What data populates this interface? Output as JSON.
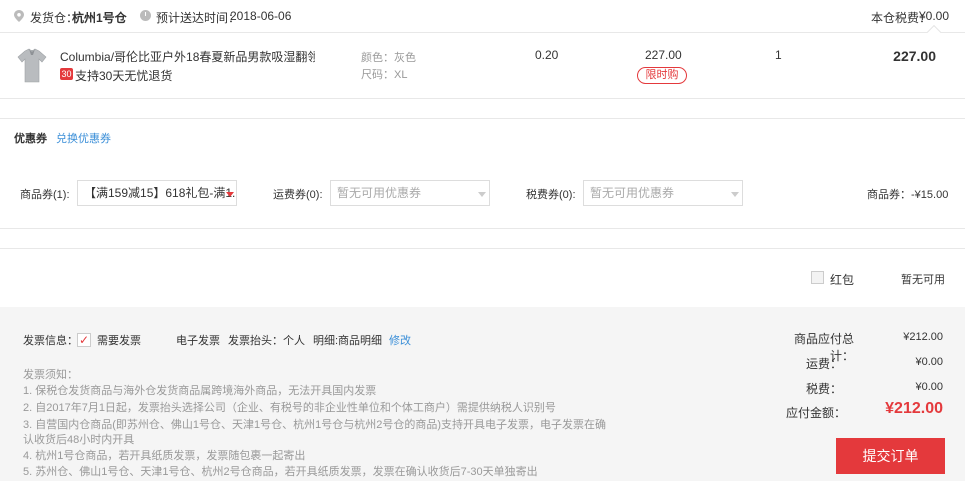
{
  "header": {
    "ship_label": "发货仓：",
    "warehouse": "杭州1号仓",
    "delivery_label": "预计送达时间：",
    "delivery_date": "2018-06-06",
    "tax_label": "本仓税费：",
    "tax_value": "¥0.00"
  },
  "product": {
    "name": "Columbia/哥伦比亚户外18春夏新品男款吸湿翻领P...",
    "badge": "30",
    "return_text": "支持30天无忧退货",
    "color_label": "颜色：灰色",
    "size_label": "尺码：XL",
    "tax_rate": "0.20",
    "price": "227.00",
    "promo_tag": "限时购",
    "quantity": "1",
    "subtotal": "227.00"
  },
  "coupons": {
    "title": "优惠券",
    "exchange_link": "兑换优惠券",
    "product_coupon_label": "商品券(1):",
    "product_coupon_value": "【满159减15】618礼包-满1...",
    "shipping_coupon_label": "运费券(0):",
    "shipping_coupon_value": "暂无可用优惠券",
    "tax_coupon_label": "税费券(0):",
    "tax_coupon_value": "暂无可用优惠券",
    "discount_text": "商品券：-¥15.00"
  },
  "red_packet": {
    "label": "红包",
    "status": "暂无可用"
  },
  "invoice": {
    "info_label": "发票信息：",
    "need_label": "需要发票",
    "type": "电子发票",
    "header_text": "发票抬头：个人",
    "detail_text": "明细:商品明细",
    "edit_link": "修改",
    "notice_title": "发票须知：",
    "notices": [
      "1. 保税仓发货商品与海外仓发货商品属跨境海外商品，无法开具国内发票",
      "2. 自2017年7月1日起，发票抬头选择公司（企业、有税号的非企业性单位和个体工商户）需提供纳税人识别号",
      "3. 自营国内仓商品(即苏州仓、佛山1号仓、天津1号仓、杭州1号仓与杭州2号仓的商品)支持开具电子发票，电子发票在确",
      "认收货后48小时内开具",
      "4. 杭州1号仓商品，若开具纸质发票，发票随包裹一起寄出",
      "5. 苏州仓、佛山1号仓、天津1号仓、杭州2号仓商品，若开具纸质发票，发票在确认收货后7-30天单独寄出"
    ]
  },
  "summary": {
    "goods_total_label": "商品应付总计：",
    "goods_total_value": "¥212.00",
    "freight_label": "运费：",
    "freight_value": "¥0.00",
    "tax_label": "税费：",
    "tax_value": "¥0.00",
    "pay_label": "应付金额：",
    "pay_value": "¥212.00",
    "submit_label": "提交订单"
  },
  "colors": {
    "accent": "#e4393c",
    "link": "#3b8fd8",
    "summary_bg": "#f5f5f5"
  },
  "icons": [
    "location-pin-icon",
    "clock-icon",
    "checkmark-icon",
    "dropdown-caret-icon"
  ]
}
